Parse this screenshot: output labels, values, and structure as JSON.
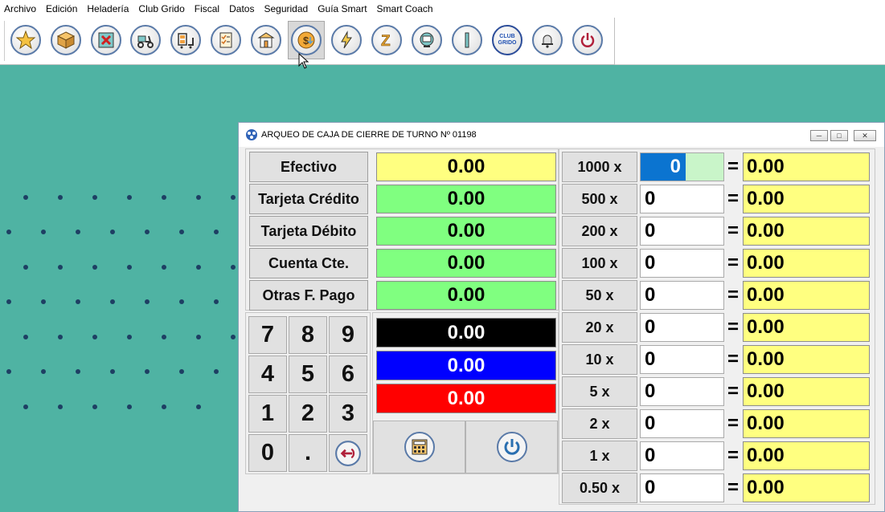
{
  "menu": [
    "Archivo",
    "Edición",
    "Heladería",
    "Club Grido",
    "Fiscal",
    "Datos",
    "Seguridad",
    "Guía Smart",
    "Smart Coach"
  ],
  "toolbar": {
    "buttons": [
      {
        "icon": "star-icon"
      },
      {
        "icon": "package-icon"
      },
      {
        "icon": "cancel-box-icon"
      },
      {
        "icon": "delivery-scooter-icon"
      },
      {
        "icon": "shelf-cart-icon"
      },
      {
        "icon": "checklist-icon"
      },
      {
        "icon": "store-icon"
      },
      {
        "icon": "cash-dollar-icon"
      },
      {
        "icon": "lightning-icon"
      },
      {
        "icon": "z-report-icon"
      },
      {
        "icon": "terminal-icon"
      },
      {
        "icon": "divider-bar-icon"
      },
      {
        "icon": "club-grido-icon",
        "text": "CLUB GRIDO"
      },
      {
        "icon": "bell-icon"
      },
      {
        "icon": "power-icon"
      }
    ]
  },
  "window": {
    "title": "ARQUEO DE CAJA DE CIERRE DE TURNO Nº 01198"
  },
  "payment_methods": [
    {
      "label": "Efectivo",
      "value": "0.00",
      "color": "#ffff80"
    },
    {
      "label": "Tarjeta Crédito",
      "value": "0.00",
      "color": "#80ff80"
    },
    {
      "label": "Tarjeta Débito",
      "value": "0.00",
      "color": "#80ff80"
    },
    {
      "label": "Cuenta Cte.",
      "value": "0.00",
      "color": "#80ff80"
    },
    {
      "label": "Otras F. Pago",
      "value": "0.00",
      "color": "#80ff80"
    }
  ],
  "totals": [
    {
      "value": "0.00",
      "color": "#000000"
    },
    {
      "value": "0.00",
      "color": "#0000ff"
    },
    {
      "value": "0.00",
      "color": "#ff0000"
    }
  ],
  "keypad": [
    "7",
    "8",
    "9",
    "4",
    "5",
    "6",
    "1",
    "2",
    "3",
    "0",
    "."
  ],
  "denominations": [
    {
      "label": "1000 x",
      "count": "0",
      "total": "0.00"
    },
    {
      "label": "500 x",
      "count": "0",
      "total": "0.00"
    },
    {
      "label": "200 x",
      "count": "0",
      "total": "0.00"
    },
    {
      "label": "100 x",
      "count": "0",
      "total": "0.00"
    },
    {
      "label": "50 x",
      "count": "0",
      "total": "0.00"
    },
    {
      "label": "20 x",
      "count": "0",
      "total": "0.00"
    },
    {
      "label": "10 x",
      "count": "0",
      "total": "0.00"
    },
    {
      "label": "5 x",
      "count": "0",
      "total": "0.00"
    },
    {
      "label": "2 x",
      "count": "0",
      "total": "0.00"
    },
    {
      "label": "1 x",
      "count": "0",
      "total": "0.00"
    },
    {
      "label": "0.50 x",
      "count": "0",
      "total": "0.00"
    }
  ],
  "equals": "=",
  "colors": {
    "desktop": "#4fb3a3",
    "dots": "#1e3f63",
    "accent": "#0b74d0"
  }
}
